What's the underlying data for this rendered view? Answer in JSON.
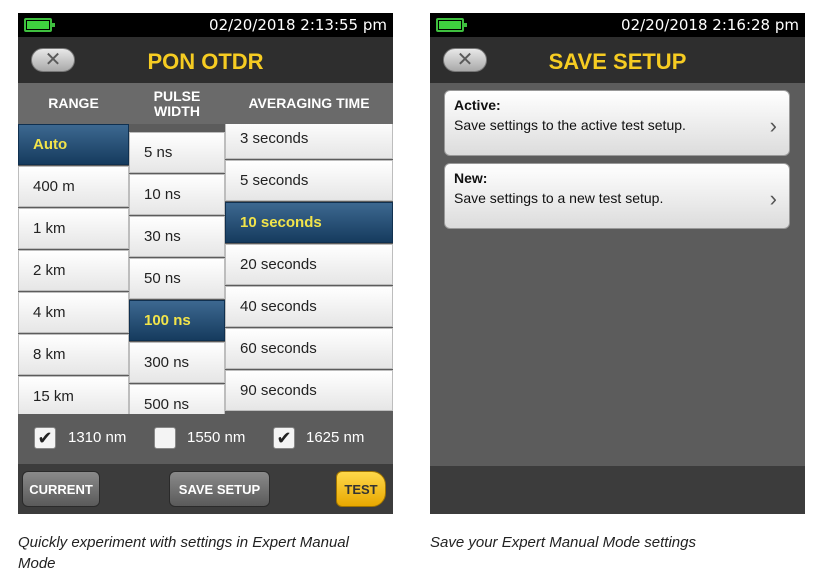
{
  "left_screen": {
    "status": {
      "datetime": "02/20/2018  2:13:55 pm",
      "battery_icon": "battery-icon"
    },
    "title": "PON OTDR",
    "back_icon": "close-icon",
    "columns": {
      "range": {
        "header": "RANGE",
        "items": [
          "Auto",
          "400 m",
          "1 km",
          "2 km",
          "4 km",
          "8 km",
          "15 km"
        ],
        "selected": "Auto"
      },
      "pulse_width": {
        "header": "PULSE WIDTH",
        "items": [
          "5 ns",
          "10 ns",
          "30 ns",
          "50 ns",
          "100 ns",
          "300 ns",
          "500 ns"
        ],
        "selected": "100 ns"
      },
      "averaging_time": {
        "header": "AVERAGING TIME",
        "items": [
          "3 seconds",
          "5 seconds",
          "10 seconds",
          "20 seconds",
          "40 seconds",
          "60 seconds",
          "90 seconds"
        ],
        "selected": "10 seconds"
      }
    },
    "wavelengths": [
      {
        "label": "1310 nm",
        "checked": true
      },
      {
        "label": "1550 nm",
        "checked": false
      },
      {
        "label": "1625 nm",
        "checked": true
      }
    ],
    "buttons": {
      "current": "CURRENT",
      "save_setup": "SAVE SETUP",
      "test": "TEST"
    }
  },
  "right_screen": {
    "status": {
      "datetime": "02/20/2018  2:16:28 pm",
      "battery_icon": "battery-icon"
    },
    "title": "SAVE SETUP",
    "back_icon": "close-icon",
    "options": [
      {
        "title": "Active:",
        "description": "Save settings to the active test setup."
      },
      {
        "title": "New:",
        "description": "Save settings to a new test setup."
      }
    ]
  },
  "captions": {
    "left": "Quickly experiment with settings in Expert Manual Mode",
    "right": "Save your Expert Manual Mode settings"
  },
  "colors": {
    "title_accent": "#f6cc22",
    "selection": "#1f4670",
    "selected_text": "#f2e44a",
    "test_button": "#f3c21e",
    "battery": "#3fd23f"
  }
}
